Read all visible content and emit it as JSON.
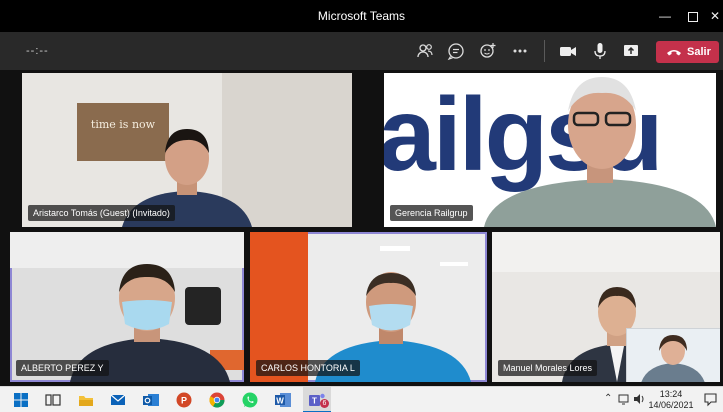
{
  "window": {
    "title": "Microsoft Teams",
    "controls": [
      "minimize",
      "maximize",
      "close"
    ]
  },
  "toolbar": {
    "timer": "--:--",
    "icons": [
      "people-icon",
      "chat-icon",
      "reactions-icon",
      "more-icon",
      "camera-icon",
      "mic-icon",
      "share-icon"
    ],
    "leave_label": "Salir",
    "leave_color": "#c4314b"
  },
  "participants": [
    {
      "name": "Aristarco Tomás (Guest) (Invitado)",
      "speaking": false
    },
    {
      "name": "Gerencia Railgrup",
      "speaking": false
    },
    {
      "name": "ALBERTO PEREZ Y",
      "speaking": true
    },
    {
      "name": "CARLOS HONTORIA L",
      "speaking": true
    },
    {
      "name": "Manuel Morales Lores",
      "speaking": false
    }
  ],
  "backgrounds": {
    "wall_sign": "time is now",
    "logo_text": "ailgsu"
  },
  "taskbar": {
    "apps": [
      "windows-start-icon",
      "task-view-icon",
      "file-explorer-icon",
      "mail-icon",
      "outlook-icon",
      "powerpoint-icon",
      "chrome-icon",
      "whatsapp-icon",
      "word-icon",
      "teams-icon"
    ],
    "teams_badge": "6",
    "time": "13:24",
    "date": "14/06/2021"
  },
  "colors": {
    "accent": "#8e87d4",
    "title_bar": "#000000",
    "toolbar": "#292929"
  }
}
